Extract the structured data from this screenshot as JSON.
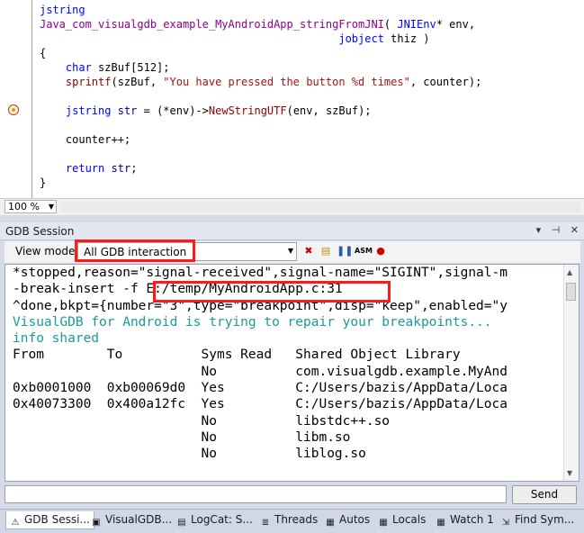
{
  "editor": {
    "lines": [
      [
        {
          "t": "jstring",
          "c": "kw"
        }
      ],
      [
        {
          "t": "Java_com_visualgdb_example_MyAndroidApp_stringFromJNI",
          "c": "fn"
        },
        {
          "t": "( ",
          "c": ""
        },
        {
          "t": "JNIEnv",
          "c": "kw"
        },
        {
          "t": "* env,",
          "c": ""
        }
      ],
      [
        {
          "t": "                                              ",
          "c": ""
        },
        {
          "t": "jobject",
          "c": "kw"
        },
        {
          "t": " thiz )",
          "c": ""
        }
      ],
      [
        {
          "t": "{",
          "c": ""
        }
      ],
      [
        {
          "t": "    ",
          "c": ""
        },
        {
          "t": "char",
          "c": "kw"
        },
        {
          "t": " szBuf[512];",
          "c": ""
        }
      ],
      [
        {
          "t": "    ",
          "c": ""
        },
        {
          "t": "sprintf",
          "c": "mac"
        },
        {
          "t": "(szBuf, ",
          "c": ""
        },
        {
          "t": "\"You have pressed the button %d times\"",
          "c": "str"
        },
        {
          "t": ", counter);",
          "c": ""
        }
      ],
      [
        {
          "t": "",
          "c": ""
        }
      ],
      [
        {
          "t": "    ",
          "c": ""
        },
        {
          "t": "jstring",
          "c": "kw"
        },
        {
          "t": " ",
          "c": ""
        },
        {
          "t": "str",
          "c": "var"
        },
        {
          "t": " = (*env)->",
          "c": ""
        },
        {
          "t": "NewStringUTF",
          "c": "mac"
        },
        {
          "t": "(env, szBuf);",
          "c": ""
        }
      ],
      [
        {
          "t": "",
          "c": ""
        }
      ],
      [
        {
          "t": "    counter++;",
          "c": ""
        }
      ],
      [
        {
          "t": "",
          "c": ""
        }
      ],
      [
        {
          "t": "    ",
          "c": ""
        },
        {
          "t": "return",
          "c": "kw"
        },
        {
          "t": " ",
          "c": ""
        },
        {
          "t": "str",
          "c": "var"
        },
        {
          "t": ";",
          "c": ""
        }
      ],
      [
        {
          "t": "}",
          "c": ""
        }
      ]
    ],
    "zoom": "100 %"
  },
  "panel": {
    "title": "GDB Session",
    "view_mode_label": "View mode",
    "view_mode_value": "All GDB interaction",
    "send_label": "Send",
    "command_value": ""
  },
  "console": [
    {
      "t": "*stopped,reason=\"signal-received\",signal-name=\"SIGINT\",signal-m",
      "c": ""
    },
    {
      "t": "-break-insert -f E:/temp/MyAndroidApp.c:31",
      "c": ""
    },
    {
      "t": "^done,bkpt={number=\"3\",type=\"breakpoint\",disp=\"keep\",enabled=\"y",
      "c": ""
    },
    {
      "t": "VisualGDB for Android is trying to repair your breakpoints...",
      "c": "teal"
    },
    {
      "t": "info shared",
      "c": "teal"
    },
    {
      "t": "From        To          Syms Read   Shared Object Library",
      "c": ""
    },
    {
      "t": "                        No          com.visualgdb.example.MyAnd",
      "c": ""
    },
    {
      "t": "0xb0001000  0xb00069d0  Yes         C:/Users/bazis/AppData/Loca",
      "c": ""
    },
    {
      "t": "0x40073300  0x400a12fc  Yes         C:/Users/bazis/AppData/Loca",
      "c": ""
    },
    {
      "t": "                        No          libstdc++.so",
      "c": ""
    },
    {
      "t": "                        No          libm.so",
      "c": ""
    },
    {
      "t": "                        No          liblog.so",
      "c": ""
    }
  ],
  "tabs": [
    {
      "label": "GDB Sessi...",
      "icon": "warning-icon",
      "active": true
    },
    {
      "label": "VisualGDB...",
      "icon": "monitor-icon",
      "active": false
    },
    {
      "label": "LogCat: S...",
      "icon": "log-icon",
      "active": false
    },
    {
      "label": "Threads",
      "icon": "threads-icon",
      "active": false
    },
    {
      "label": "Autos",
      "icon": "autos-icon",
      "active": false
    },
    {
      "label": "Locals",
      "icon": "locals-icon",
      "active": false
    },
    {
      "label": "Watch 1",
      "icon": "watch-icon",
      "active": false
    },
    {
      "label": "Find Sym...",
      "icon": "find-icon",
      "active": false
    }
  ],
  "colors": {
    "highlight_box": "#ff1a1a",
    "teal_text": "#1a9a9a",
    "keyword": "#0000ff"
  }
}
